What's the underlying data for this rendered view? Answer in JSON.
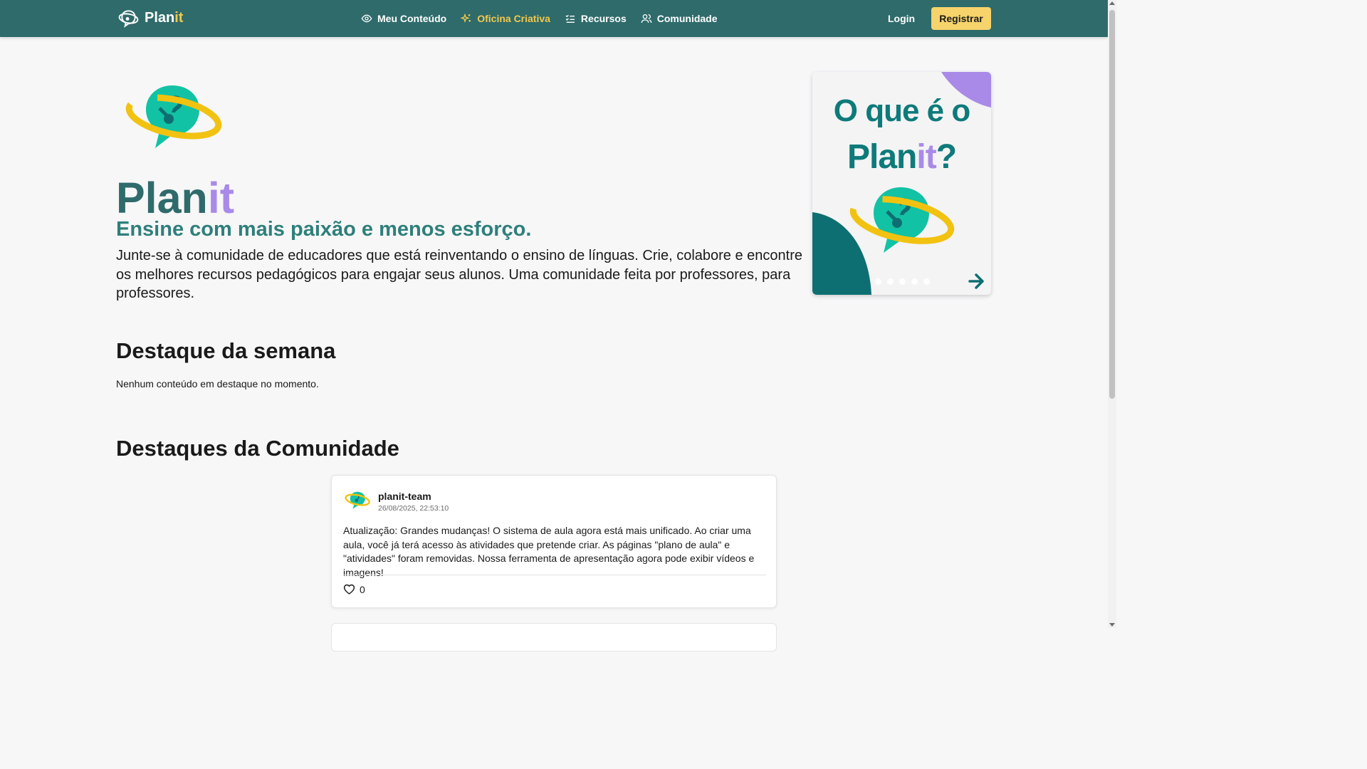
{
  "navbar": {
    "brand": {
      "part1": "Plan",
      "part2": "it"
    },
    "links": [
      {
        "label": "Meu Conteúdo",
        "icon": "eye-icon"
      },
      {
        "label": "Oficina Criativa",
        "icon": "sparkles-icon",
        "active": true
      },
      {
        "label": "Recursos",
        "icon": "checklist-icon"
      },
      {
        "label": "Comunidade",
        "icon": "users-icon"
      }
    ],
    "login_label": "Login",
    "register_label": "Registrar"
  },
  "hero": {
    "title_part1": "Plan",
    "title_part2": "it",
    "subtitle": "Ensine com mais paixão e menos esforço.",
    "description": "Junte-se à comunidade de educadores que está reinventando o ensino de línguas. Crie, colabore e encontre os melhores recursos pedagógicos para engajar seus alunos. Uma comunidade feita por professores, para professores."
  },
  "carousel": {
    "slide_heading_line1": "O que é o",
    "slide_heading_line2_part1": "Plan",
    "slide_heading_line2_part2": "it",
    "slide_heading_line2_part3": "?",
    "dot_count": 5,
    "active_dot": 0
  },
  "featured_week": {
    "title": "Destaque da semana",
    "empty_message": "Nenhum conteúdo em destaque no momento."
  },
  "community": {
    "title": "Destaques da Comunidade",
    "posts": [
      {
        "author": "planit-team",
        "date": "26/08/2025, 22:53:10",
        "body": "Atualização: Grandes mudanças! O sistema de aula agora está mais unificado. Ao criar uma aula, você já terá acesso às atividades que pretende criar. As páginas \"plano de aula\" e \"atividades\" foram removidas. Nossa ferramenta de apresentação agora pode exibir vídeos e imagens!",
        "likes": "0"
      }
    ]
  },
  "colors": {
    "navbar": "#2f6b6b",
    "brand_accent": "#f2c94c",
    "title_teal": "#2f6b6b",
    "title_purple": "#a98ae8",
    "register_bg": "#f6d36b",
    "logo_teal": "#12c2a4",
    "logo_dark": "#0e6f72",
    "logo_ring": "#f2c211"
  }
}
